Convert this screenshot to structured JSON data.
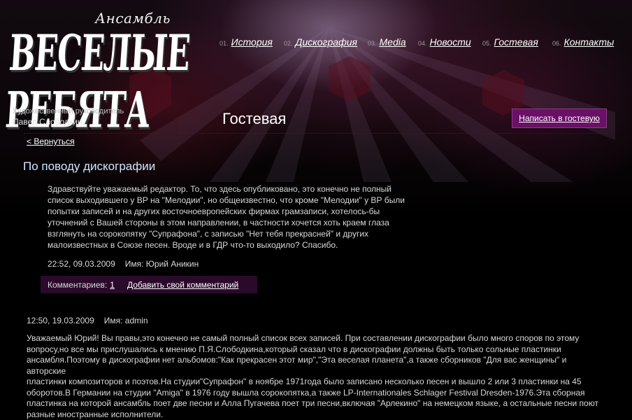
{
  "logo": {
    "small_text": "Ансамбль",
    "big_text": "ВЕСЕЛЫЕ РЕБЯТА"
  },
  "nav": [
    {
      "num": "01.",
      "label": "История"
    },
    {
      "num": "02.",
      "label": "Дискография"
    },
    {
      "num": "03.",
      "label": "Media"
    },
    {
      "num": "04.",
      "label": "Новости"
    },
    {
      "num": "05.",
      "label": "Гостевая"
    },
    {
      "num": "06.",
      "label": "Контакты"
    }
  ],
  "director": {
    "role": "Художественный руководитель",
    "name": "Павел Слободкин"
  },
  "page_title": "Гостевая",
  "write_button": "Написать в гостевую",
  "back_link": "< Вернуться",
  "post": {
    "title": "По поводу дискографии",
    "lines": [
      "Здравствуйте уважаемый редактор. То, что здесь опубликовано, это конечно не полный",
      "список выходившего у ВР на \"Мелодии\", но общеизвестно, что кроме \"Мелодии\" у ВР были",
      "попытки записей и на других восточноевропейских фирмах грамзаписи, хотелось-бы",
      "уточнений с Вашей стороны в этом направлении, в частности хочется хоть краем глаза",
      "взглянуть на сорокопятку \"Супрафона\", с записью \"Нет тебя прекрасней\" и других",
      "малоизвестных в Союзе песен. Вроде и в ГДР что-то выходило? Спасибо."
    ],
    "datetime": "22:52, 09.03.2009",
    "author": "Имя: Юрий Аникин",
    "comments_label": "Комментариев:",
    "comments_count": "1",
    "add_comment": "Добавить свой комментарий"
  },
  "reply": {
    "datetime": "12:50, 19.03.2009",
    "author": "Имя: admin",
    "lines": [
      "Уважаемый Юрий! Вы правы,это конечно не самый полный список всех записей. При составлении дискографии было много споров по этому",
      "вопросу,но все мы прислушались к мнению П.Я.Слободкина,который сказал что в дискографии должны быть только сольные пластинки",
      "ансамбля.Поэтому в дискографии нет альбомов:\"Как прекрасен этот мир\",\"Эта веселая планета\",а также сборников \"Для вас женщины\" и авторские",
      "пластинки композиторов и поэтов.На студии\"Супрафон\" в ноябре 1971года было записано несколько песен и вышло 2 или 3 пластинки на 45",
      "оборотов.В Германии на студии \"Amiga\" в 1976 году вышла сорокопятка,а также LP-Internationales Schlager Festival Dresden-1976.Эта сборная",
      "пластинка на которой ансамбль поет две песни и Алла Пугачева поет три песни,включая \"Арлекино\" на немецком языке, а остальные песни поют",
      "разные иностранные исполнители."
    ]
  },
  "colors": {
    "button_bg": "#6a1067",
    "comments_bar_bg": "#2a0a2a",
    "post_title": "#cfe6ff"
  }
}
